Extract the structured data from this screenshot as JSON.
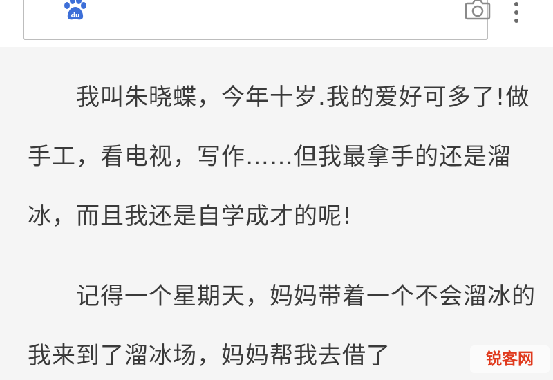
{
  "search": {
    "value": "",
    "placeholder": ""
  },
  "icons": {
    "logo": "paw-icon",
    "camera": "camera-icon",
    "menu": "more-vertical-icon"
  },
  "colors": {
    "logo_blue": "#3d6fd8",
    "text": "#3a3a3a",
    "watermark_red": "#e03a1e",
    "page_background": "#f5f5f5"
  },
  "article": {
    "paragraphs": [
      "我叫朱晓蝶，今年十岁.我的爱好可多了!做手工，看电视，写作……但我最拿手的还是溜冰，而且我还是自学成才的呢!",
      "记得一个星期天，妈妈带着一个不会溜冰的我来到了溜冰场，妈妈帮我去借了"
    ]
  },
  "watermark": {
    "text": "锐客网"
  }
}
